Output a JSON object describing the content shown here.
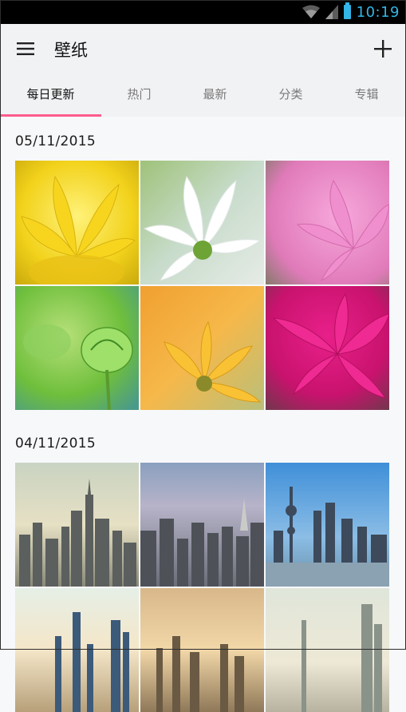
{
  "status_bar": {
    "time": "10:19"
  },
  "app_bar": {
    "title": "壁纸"
  },
  "tabs": [
    {
      "label": "每日更新",
      "active": true
    },
    {
      "label": "热门",
      "active": false
    },
    {
      "label": "最新",
      "active": false
    },
    {
      "label": "分类",
      "active": false
    },
    {
      "label": "专辑",
      "active": false
    }
  ],
  "sections": [
    {
      "date": "05/11/2015",
      "wallpapers": [
        {
          "subject": "yellow flower"
        },
        {
          "subject": "white flower"
        },
        {
          "subject": "pink flower"
        },
        {
          "subject": "green flower bud"
        },
        {
          "subject": "orange flower"
        },
        {
          "subject": "magenta flower"
        }
      ]
    },
    {
      "date": "04/11/2015",
      "wallpapers": [
        {
          "subject": "city skyline"
        },
        {
          "subject": "city skyline"
        },
        {
          "subject": "city skyline waterfront"
        },
        {
          "subject": "city skyline"
        },
        {
          "subject": "city skyline"
        },
        {
          "subject": "city skyline"
        }
      ]
    }
  ],
  "colors": {
    "accent": "#ff5c8d",
    "status_clock": "#33b5e5"
  }
}
